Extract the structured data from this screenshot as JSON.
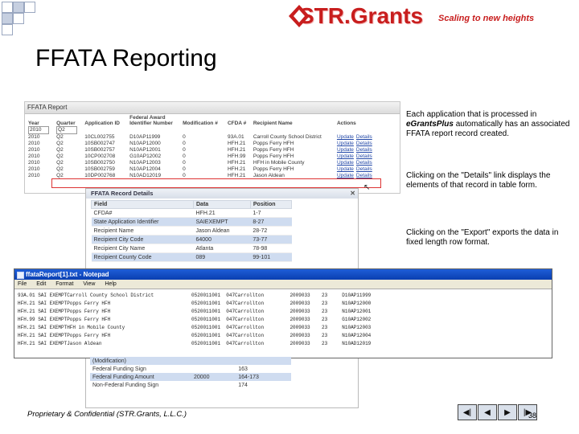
{
  "header": {
    "logo_text": "STR.Grants",
    "tagline": "Scaling to new heights",
    "brand_color": "#c81e1e"
  },
  "slide": {
    "title": "FFATA Reporting",
    "footer": "Proprietary & Confidential (STR.Grants, L.L.C.)",
    "page_number": "38"
  },
  "report": {
    "window_title": "FFATA Report",
    "columns": [
      "Year",
      "Quarter",
      "Application ID",
      "Federal Award Identifier Number",
      "Modification #",
      "CFDA #",
      "Recipient Name",
      "Actions"
    ],
    "filter_year": "2010",
    "filter_quarter": "Q2",
    "rows": [
      [
        "2010",
        "Q2",
        "10CL002755",
        "D10AP11999",
        "0",
        "93A.01",
        "Carroll County School District",
        "Update",
        "Details"
      ],
      [
        "2010",
        "Q2",
        "10SB002747",
        "N10AP12000",
        "0",
        "HFH.21",
        "Popps Ferry HFH",
        "Update",
        "Details"
      ],
      [
        "2010",
        "Q2",
        "10SB002757",
        "N10AP12001",
        "0",
        "HFH.21",
        "Popps Ferry HFH",
        "Update",
        "Details"
      ],
      [
        "2010",
        "Q2",
        "10CP002708",
        "G10AP12002",
        "0",
        "HFH.99",
        "Popps Ferry HFH",
        "Update",
        "Details"
      ],
      [
        "2010",
        "Q2",
        "10SB002750",
        "N10AP12003",
        "0",
        "HFH.21",
        "HFH in Mobile County",
        "Update",
        "Details"
      ],
      [
        "2010",
        "Q2",
        "10SB002759",
        "N10AP12004",
        "0",
        "HFH.21",
        "Popps Ferry HFH",
        "Update",
        "Details"
      ],
      [
        "2010",
        "Q2",
        "10DP002768",
        "N10AD12019",
        "0",
        "HFH.21",
        "Jason Aldean",
        "Update",
        "Details"
      ]
    ]
  },
  "details": {
    "window_title": "FFATA Record Details",
    "columns": [
      "Field",
      "Data",
      "Position"
    ],
    "rows": [
      [
        "CFDA#",
        "HFH.21",
        "1-7"
      ],
      [
        "State Application Identifier",
        "SAIEXEMPT",
        "8-27"
      ],
      [
        "Recipient Name",
        "Jason Aldean",
        "28-72"
      ],
      [
        "Recipient City Code",
        "64000",
        "73-77"
      ],
      [
        "Recipient City Name",
        "Atlanta",
        "78-98"
      ],
      [
        "Recipient County Code",
        "089",
        "99-101"
      ]
    ],
    "lower_rows": [
      [
        "(Modification)",
        "",
        ""
      ],
      [
        "Federal Funding Sign",
        "",
        "163"
      ],
      [
        "Federal Funding Amount",
        "20000",
        "164-173"
      ],
      [
        "Non-Federal Funding Sign",
        "",
        "174"
      ]
    ]
  },
  "notepad": {
    "title": "ffataReport[1].txt - Notepad",
    "menu": [
      "File",
      "Edit",
      "Format",
      "View",
      "Help"
    ],
    "lines": [
      "93A.01 SAI EXEMPTCarroll County School District             0520011001  047Carrollton         2009033    23     D10AP11999",
      "HFH.21 SAI EXEMPTPopps Ferry HFH                            0520011001  047Carrollton         2009033    23     N10AP12000",
      "HFH.21 SAI EXEMPTPopps Ferry HFH                            0520011001  047Carrollton         2009033    23     N10AP12001",
      "HFH.99 SAI EXEMPTPopps Ferry HFH                            0520011001  047Carrollton         2009033    23     G10AP12002",
      "HFH.21 SAI EXEMPTHFH in Mobile County                       0520011001  047Carrollton         2009033    23     N10AP12003",
      "HFH.21 SAI EXEMPTPopps Ferry HFH                            0520011001  047Carrollton         2009033    23     N10AP12004",
      "HFH.21 SAI EXEMPTJason Aldean                               0520011001  047Carrollton         2009033    23     N10AD12019"
    ]
  },
  "descriptions": {
    "p1_pre": "Each application that is processed in ",
    "p1_brand": "eGrants",
    "p1_plus": "Plus",
    "p1_post": " automatically has an associated FFATA report record created.",
    "p2": "Clicking on the \"Details\" link displays the elements of that record in table form.",
    "p3": "Clicking on the \"Export\" exports the data in fixed length row format."
  },
  "nav": {
    "first_icon": "first-slide-icon",
    "prev_icon": "previous-slide-icon",
    "next_icon": "next-slide-icon",
    "last_icon": "last-slide-icon"
  }
}
